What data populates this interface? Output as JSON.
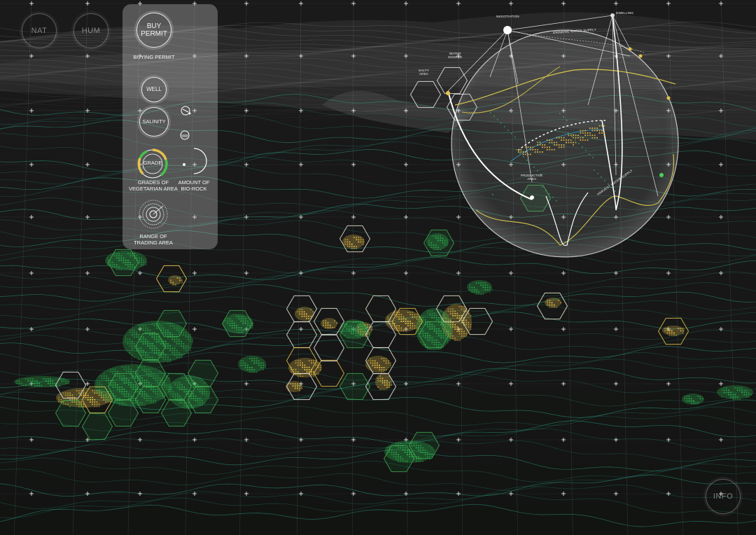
{
  "nav": {
    "nat_label": "NAT",
    "hum_label": "HUM"
  },
  "panel": {
    "buy_permit_label": "BUY\nPERMIT",
    "buying_permit_caption": "BUYING PERMIT",
    "well_label": "WELL",
    "salinity_label": "SALINITY",
    "grade_label": "GRADE",
    "grades_caption": "GRADES OF\nVEGETARIAN AREA",
    "bio_rock_caption": "AMOUNT OF\nBIO-ROCK",
    "trading_caption": "RANGE OF\nTRADING AREA"
  },
  "info_label": "INFO",
  "globe": {
    "negotiation": "NEGOTIATION",
    "dwelling": "DWELLING",
    "water_source": "WATER\nSOURCE",
    "salty_area": "SALTY\nAREA",
    "productive_area": "PRODUCTIVE\nAREA",
    "drinking_water_supply": "DRINKING WATER SUPPLY",
    "harvest_water_supply": "HARVEST WATER SUPPLY"
  },
  "colors": {
    "accent_yellow": "#e8c24a",
    "accent_green": "#2fae4f",
    "contour": "#2aa88a",
    "panel": "#cfcfcf"
  },
  "hexes": [
    {
      "c": [
        245,
        398
      ],
      "t": "yellow-dark"
    },
    {
      "c": [
        507,
        341
      ],
      "t": "mix"
    },
    {
      "c": [
        627,
        347
      ],
      "t": "green"
    },
    {
      "c": [
        431,
        441
      ],
      "t": "white"
    },
    {
      "c": [
        470,
        459
      ],
      "t": "white-yellow"
    },
    {
      "c": [
        544,
        441
      ],
      "t": "white-yellow"
    },
    {
      "c": [
        582,
        459
      ],
      "t": "yellow"
    },
    {
      "c": [
        645,
        441
      ],
      "t": "white-yellow"
    },
    {
      "c": [
        682,
        459
      ],
      "t": "white-yellow"
    },
    {
      "c": [
        789,
        437
      ],
      "t": "white-yellow"
    },
    {
      "c": [
        962,
        473
      ],
      "t": "yellow"
    },
    {
      "c": [
        431,
        478
      ],
      "t": "white-yellow"
    },
    {
      "c": [
        507,
        478
      ],
      "t": "green"
    },
    {
      "c": [
        544,
        478
      ],
      "t": "white"
    },
    {
      "c": [
        620,
        478
      ],
      "t": "green"
    },
    {
      "c": [
        470,
        497
      ],
      "t": "white"
    },
    {
      "c": [
        431,
        515
      ],
      "t": "yellow"
    },
    {
      "c": [
        470,
        533
      ],
      "t": "yellow"
    },
    {
      "c": [
        544,
        515
      ],
      "t": "white-yellow"
    },
    {
      "c": [
        431,
        552
      ],
      "t": "white"
    },
    {
      "c": [
        507,
        552
      ],
      "t": "green"
    },
    {
      "c": [
        544,
        552
      ],
      "t": "white"
    },
    {
      "c": [
        101,
        550
      ],
      "t": "white"
    },
    {
      "c": [
        139,
        571
      ],
      "t": "yellow"
    },
    {
      "c": [
        101,
        590
      ],
      "t": "green"
    },
    {
      "c": [
        139,
        609
      ],
      "t": "green"
    },
    {
      "c": [
        176,
        590
      ],
      "t": "green"
    },
    {
      "c": [
        215,
        571
      ],
      "t": "green"
    },
    {
      "c": [
        252,
        552
      ],
      "t": "green"
    },
    {
      "c": [
        290,
        533
      ],
      "t": "green"
    },
    {
      "c": [
        215,
        533
      ],
      "t": "green"
    },
    {
      "c": [
        176,
        552
      ],
      "t": "green"
    },
    {
      "c": [
        252,
        590
      ],
      "t": "green"
    },
    {
      "c": [
        290,
        571
      ],
      "t": "green"
    },
    {
      "c": [
        339,
        462
      ],
      "t": "green"
    },
    {
      "c": [
        215,
        495
      ],
      "t": "green"
    },
    {
      "c": [
        245,
        462
      ],
      "t": "green"
    },
    {
      "c": [
        176,
        375
      ],
      "t": "green"
    },
    {
      "c": [
        570,
        655
      ],
      "t": "green"
    },
    {
      "c": [
        606,
        636
      ],
      "t": "green"
    },
    {
      "c": [
        608,
        135
      ],
      "t": "white"
    },
    {
      "c": [
        646,
        115
      ],
      "t": "white"
    },
    {
      "c": [
        660,
        153
      ],
      "t": "white"
    },
    {
      "c": [
        765,
        283
      ],
      "t": "green"
    }
  ],
  "blobs": [
    {
      "c": [
        505,
        345
      ],
      "r": [
        16,
        10
      ],
      "col": "y"
    },
    {
      "c": [
        250,
        400
      ],
      "r": [
        10,
        7
      ],
      "col": "y"
    },
    {
      "c": [
        435,
        448
      ],
      "r": [
        14,
        10
      ],
      "col": "y"
    },
    {
      "c": [
        470,
        462
      ],
      "r": [
        12,
        8
      ],
      "col": "y"
    },
    {
      "c": [
        576,
        458
      ],
      "r": [
        26,
        16
      ],
      "col": "y"
    },
    {
      "c": [
        652,
        460
      ],
      "r": [
        22,
        26
      ],
      "col": "y"
    },
    {
      "c": [
        436,
        525
      ],
      "r": [
        24,
        14
      ],
      "col": "y"
    },
    {
      "c": [
        540,
        520
      ],
      "r": [
        18,
        12
      ],
      "col": "y"
    },
    {
      "c": [
        548,
        545
      ],
      "r": [
        12,
        12
      ],
      "col": "y"
    },
    {
      "c": [
        790,
        432
      ],
      "r": [
        12,
        7
      ],
      "col": "y"
    },
    {
      "c": [
        962,
        472
      ],
      "r": [
        16,
        7
      ],
      "col": "y"
    },
    {
      "c": [
        120,
        568
      ],
      "r": [
        40,
        14
      ],
      "col": "y"
    },
    {
      "c": [
        420,
        552
      ],
      "r": [
        12,
        8
      ],
      "col": "y"
    },
    {
      "c": [
        520,
        470
      ],
      "r": [
        12,
        10
      ],
      "col": "y"
    },
    {
      "c": [
        180,
        372
      ],
      "r": [
        30,
        14
      ],
      "col": "g"
    },
    {
      "c": [
        225,
        488
      ],
      "r": [
        50,
        30
      ],
      "col": "g"
    },
    {
      "c": [
        190,
        550
      ],
      "r": [
        55,
        30
      ],
      "col": "g"
    },
    {
      "c": [
        270,
        560
      ],
      "r": [
        30,
        24
      ],
      "col": "g"
    },
    {
      "c": [
        340,
        462
      ],
      "r": [
        22,
        14
      ],
      "col": "g"
    },
    {
      "c": [
        505,
        470
      ],
      "r": [
        20,
        14
      ],
      "col": "g"
    },
    {
      "c": [
        620,
        470
      ],
      "r": [
        26,
        30
      ],
      "col": "g"
    },
    {
      "c": [
        685,
        410
      ],
      "r": [
        18,
        10
      ],
      "col": "g"
    },
    {
      "c": [
        585,
        645
      ],
      "r": [
        36,
        16
      ],
      "col": "g"
    },
    {
      "c": [
        625,
        345
      ],
      "r": [
        16,
        12
      ],
      "col": "g"
    },
    {
      "c": [
        60,
        545
      ],
      "r": [
        40,
        8
      ],
      "col": "g"
    },
    {
      "c": [
        1050,
        560
      ],
      "r": [
        26,
        10
      ],
      "col": "g"
    },
    {
      "c": [
        990,
        570
      ],
      "r": [
        16,
        8
      ],
      "col": "g"
    },
    {
      "c": [
        360,
        520
      ],
      "r": [
        20,
        12
      ],
      "col": "g"
    }
  ]
}
